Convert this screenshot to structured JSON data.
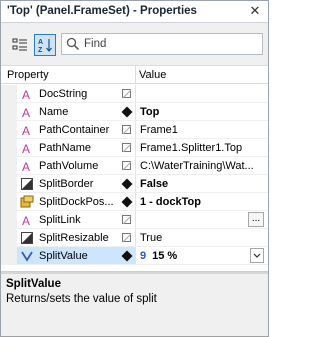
{
  "window": {
    "title": "'Top' (Panel.FrameSet) - Properties",
    "close_glyph": "✕"
  },
  "toolbar": {
    "categorized_icon": "categorized-view-icon",
    "alphabetical_icon": "alphabetical-sort-icon",
    "search": {
      "placeholder": "Find",
      "value": ""
    }
  },
  "grid": {
    "header": {
      "property": "Property",
      "value": "Value"
    },
    "rows": [
      {
        "icon": "string-property-icon",
        "name": "DocString",
        "mark": "empty",
        "value": "",
        "bold": false
      },
      {
        "icon": "string-property-icon",
        "name": "Name",
        "mark": "filled",
        "value": "Top",
        "bold": true
      },
      {
        "icon": "string-property-icon",
        "name": "PathContainer",
        "mark": "empty",
        "value": "Frame1",
        "bold": false
      },
      {
        "icon": "string-property-icon",
        "name": "PathName",
        "mark": "empty",
        "value": "Frame1.Splitter1.Top",
        "bold": false
      },
      {
        "icon": "string-property-icon",
        "name": "PathVolume",
        "mark": "empty",
        "value": "C:\\WaterTraining\\Wat...",
        "bold": false
      },
      {
        "icon": "boolean-property-icon",
        "name": "SplitBorder",
        "mark": "filled",
        "value": "False",
        "bold": true
      },
      {
        "icon": "enum-property-icon",
        "name": "SplitDockPos...",
        "mark": "filled",
        "value": "1 - dockTop",
        "bold": true
      },
      {
        "icon": "string-property-icon",
        "name": "SplitLink",
        "mark": "empty",
        "value": "",
        "bold": false,
        "button": "..."
      },
      {
        "icon": "boolean-property-icon",
        "name": "SplitResizable",
        "mark": "empty",
        "value": "True",
        "bold": false
      },
      {
        "icon": "numeric-property-icon",
        "name": "SplitValue",
        "mark": "filled",
        "value": "15 %",
        "bold": true,
        "prefix": "9",
        "selected": true,
        "dropdown": true
      }
    ]
  },
  "description": {
    "title": "SplitValue",
    "text": "Returns/sets the value of split"
  },
  "colors": {
    "accent": "#2f7ac7",
    "selection": "#cde6fb",
    "string_icon": "#c0399a"
  }
}
